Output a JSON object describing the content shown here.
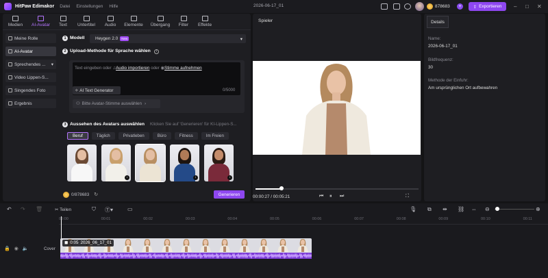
{
  "app": {
    "name": "HitPaw Edimakor",
    "menu": [
      "Datei",
      "Einstellungen",
      "Hilfe"
    ],
    "doc_title": "2026-06-17_01",
    "credits": "878683",
    "export_label": "Exportieren"
  },
  "toolbar_tabs": [
    {
      "label": "Medien",
      "icon": "media-icon"
    },
    {
      "label": "AI-Avatar",
      "icon": "ai-avatar-icon"
    },
    {
      "label": "Text",
      "icon": "text-icon"
    },
    {
      "label": "Untertitel",
      "icon": "subtitle-icon"
    },
    {
      "label": "Audio",
      "icon": "audio-icon"
    },
    {
      "label": "Elemente",
      "icon": "elements-icon"
    },
    {
      "label": "Übergang",
      "icon": "transition-icon"
    },
    {
      "label": "Filter",
      "icon": "filter-icon"
    },
    {
      "label": "Effekte",
      "icon": "effects-icon"
    }
  ],
  "sidebar": [
    {
      "label": "Meine Rolle"
    },
    {
      "label": "AI-Avatar"
    },
    {
      "label": "Sprechendes ..."
    },
    {
      "label": "Video Lippen-S..."
    },
    {
      "label": "Singendes Foto"
    },
    {
      "label": "Ergebnis"
    }
  ],
  "step1": {
    "num": "1",
    "label": "Modell",
    "model": "Heygen 2.0",
    "badge": "New"
  },
  "step2": {
    "num": "2",
    "label": "Upload-Methode für Sprache wählen",
    "placeholder_prefix": "Text eingeben oder",
    "import_audio": "Audio importieren",
    "or": "oder",
    "record_voice": "Stimme aufnehmen",
    "ai_text_generator": "AI Text Generator",
    "counter": "0/5000",
    "voice_select": "Bitte Avatar-Stimme auswählen"
  },
  "step3": {
    "num": "3",
    "label": "Aussehen des Avatars auswählen",
    "hint": "Klicken Sie auf 'Generieren' für KI-Lippen-S...",
    "categories": [
      "Beruf",
      "Täglich",
      "Privatleben",
      "Büro",
      "Fitness",
      "Im Freien"
    ]
  },
  "bottom": {
    "credits": "0/878683",
    "generate_label": "Generieren"
  },
  "player": {
    "label": "Spieler",
    "current": "00:00:27",
    "total": "00:05:21",
    "progress": 0.16
  },
  "details": {
    "tab": "Details",
    "name_label": "Name:",
    "name_value": "2026-06-17_01",
    "fps_label": "Bildfrequenz:",
    "fps_value": "30",
    "insert_label": "Methode der Einfuhr:",
    "insert_value": "Am ursprünglichen Ort aufbewahren"
  },
  "timeline": {
    "split_label": "Teilen",
    "ticks": [
      "00:00",
      "00:01",
      "00:02",
      "00:03",
      "00:04",
      "00:05",
      "00:06",
      "00:07",
      "00:08",
      "00:09",
      "00:10",
      "00:11"
    ],
    "track_name": "Cover",
    "clip_duration": "0:05",
    "clip_name": "2026_06_17_01"
  }
}
